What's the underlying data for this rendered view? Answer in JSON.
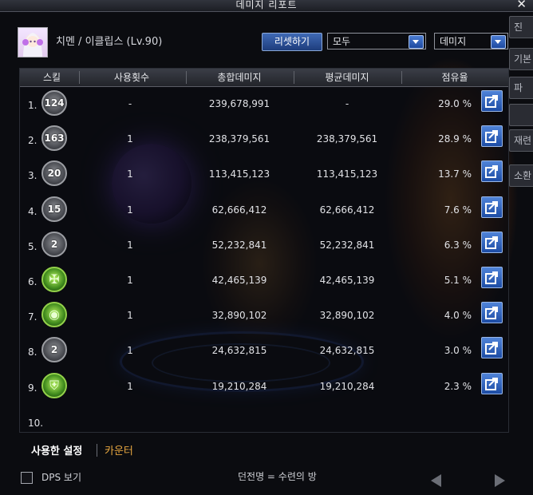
{
  "window": {
    "title": "데미지 리포트",
    "close_glyph": "✕"
  },
  "side_panel": [
    "진",
    "기본",
    "파",
    "",
    "재련",
    "소환"
  ],
  "header": {
    "character": "치멘 / 이클립스 (Lv.90)",
    "reset_label": "리셋하기",
    "filter_selected": "모두",
    "metric_selected": "데미지"
  },
  "table": {
    "columns": [
      "스킬",
      "사용횟수",
      "총합데미지",
      "평균데미지",
      "점유율"
    ],
    "rows": [
      {
        "rank": "1.",
        "icon_label": "124",
        "icon_style": "gray",
        "icon_name": "skill-icon-124",
        "uses": "-",
        "total": "239,678,991",
        "avg": "-",
        "share": "29.0 %",
        "share_value": 29.0
      },
      {
        "rank": "2.",
        "icon_label": "163",
        "icon_style": "gray",
        "icon_name": "skill-icon-163",
        "uses": "1",
        "total": "238,379,561",
        "avg": "238,379,561",
        "share": "28.9 %",
        "share_value": 28.9
      },
      {
        "rank": "3.",
        "icon_label": "20",
        "icon_style": "gray",
        "icon_name": "skill-icon-20",
        "uses": "1",
        "total": "113,415,123",
        "avg": "113,415,123",
        "share": "13.7 %",
        "share_value": 13.7
      },
      {
        "rank": "4.",
        "icon_label": "15",
        "icon_style": "gray",
        "icon_name": "skill-icon-15",
        "uses": "1",
        "total": "62,666,412",
        "avg": "62,666,412",
        "share": "7.6 %",
        "share_value": 7.6
      },
      {
        "rank": "5.",
        "icon_label": "2",
        "icon_style": "gray",
        "icon_name": "skill-icon-2",
        "uses": "1",
        "total": "52,232,841",
        "avg": "52,232,841",
        "share": "6.3 %",
        "share_value": 6.3
      },
      {
        "rank": "6.",
        "icon_label": "",
        "icon_style": "green",
        "icon_name": "rune-icon",
        "uses": "1",
        "total": "42,465,139",
        "avg": "42,465,139",
        "share": "5.1 %",
        "share_value": 5.1
      },
      {
        "rank": "7.",
        "icon_label": "",
        "icon_style": "green",
        "icon_name": "eye-sigil-icon",
        "uses": "1",
        "total": "32,890,102",
        "avg": "32,890,102",
        "share": "4.0 %",
        "share_value": 4.0
      },
      {
        "rank": "8.",
        "icon_label": "2",
        "icon_style": "gray",
        "icon_name": "skill-icon-2b",
        "uses": "1",
        "total": "24,632,815",
        "avg": "24,632,815",
        "share": "3.0 %",
        "share_value": 3.0
      },
      {
        "rank": "9.",
        "icon_label": "",
        "icon_style": "green",
        "icon_name": "shield-icon",
        "uses": "1",
        "total": "19,210,284",
        "avg": "19,210,284",
        "share": "2.3 %",
        "share_value": 2.3
      },
      {
        "rank": "10.",
        "icon_label": "",
        "icon_style": "none",
        "icon_name": "",
        "uses": "",
        "total": "",
        "avg": "",
        "share": "",
        "share_value": null
      }
    ]
  },
  "tabs": [
    {
      "label": "사용한 설정",
      "active": true
    },
    {
      "label": "카운터",
      "active": false
    }
  ],
  "footer": {
    "dps_label": "DPS 보기",
    "dungeon": "던전명 = 수련의 방"
  },
  "colors": {
    "accent_blue": "#2f5fb3",
    "active_tab": "#ffffff",
    "inactive_tab": "#e6a640"
  }
}
